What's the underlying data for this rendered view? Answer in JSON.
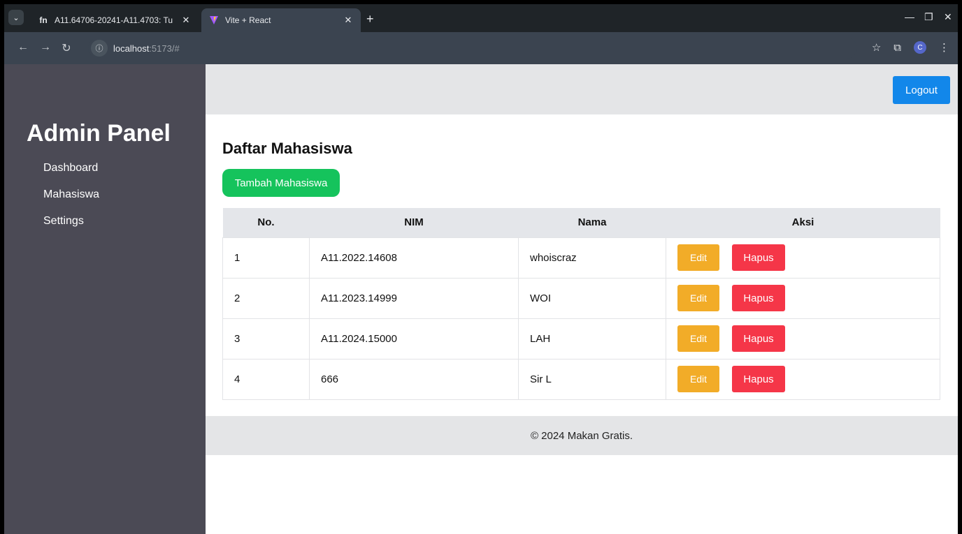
{
  "browser": {
    "tabs": [
      {
        "title": "A11.64706-20241-A11.4703: Tu",
        "favicon": "fn",
        "active": false
      },
      {
        "title": "Vite + React",
        "favicon": "vite-logo",
        "active": true
      }
    ],
    "url_host": "localhost",
    "url_path": ":5173/#"
  },
  "sidebar": {
    "title": "Admin Panel",
    "items": [
      {
        "label": "Dashboard"
      },
      {
        "label": "Mahasiswa"
      },
      {
        "label": "Settings"
      }
    ]
  },
  "header": {
    "logout_label": "Logout"
  },
  "main": {
    "title": "Daftar Mahasiswa",
    "add_label": "Tambah Mahasiswa",
    "columns": [
      "No.",
      "NIM",
      "Nama",
      "Aksi"
    ],
    "rows": [
      {
        "no": "1",
        "nim": "A11.2022.14608",
        "nama": "whoiscraz"
      },
      {
        "no": "2",
        "nim": "A11.2023.14999",
        "nama": "WOI"
      },
      {
        "no": "3",
        "nim": "A11.2024.15000",
        "nama": "LAH"
      },
      {
        "no": "4",
        "nim": "666",
        "nama": "Sir L"
      }
    ],
    "edit_label": "Edit",
    "delete_label": "Hapus"
  },
  "footer": {
    "text": "© 2024 Makan Gratis."
  },
  "colors": {
    "sidebar": "#4b4a55",
    "logout": "#1287ea",
    "add": "#15c35c",
    "edit": "#f2ac28",
    "delete": "#f53648"
  }
}
